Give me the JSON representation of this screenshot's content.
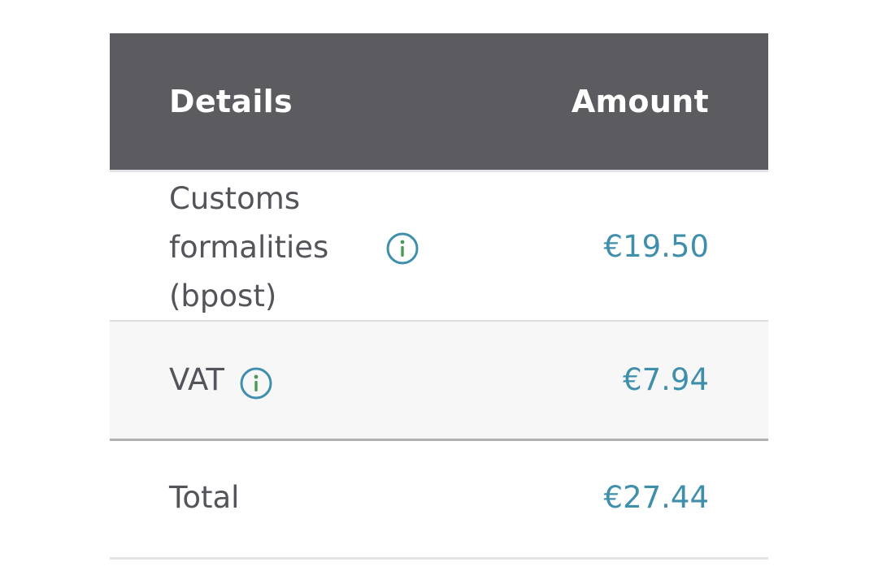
{
  "header": {
    "details": "Details",
    "amount": "Amount"
  },
  "rows": [
    {
      "label": "Customs formalities (bpost)",
      "amount": "€19.50",
      "has_info_icon": true
    },
    {
      "label": "VAT",
      "amount": "€7.94",
      "has_info_icon": true
    }
  ],
  "total": {
    "label": "Total",
    "amount": "€27.44"
  },
  "icons": {
    "info": "info-icon"
  },
  "colors": {
    "header_bg": "#5c5b60",
    "header_text": "#ffffff",
    "label_text": "#55545a",
    "amount_text": "#3f8fac",
    "info_ring": "#3f8fac",
    "info_glyph": "#4a9a56",
    "vat_row_bg": "#f7f7f7"
  }
}
